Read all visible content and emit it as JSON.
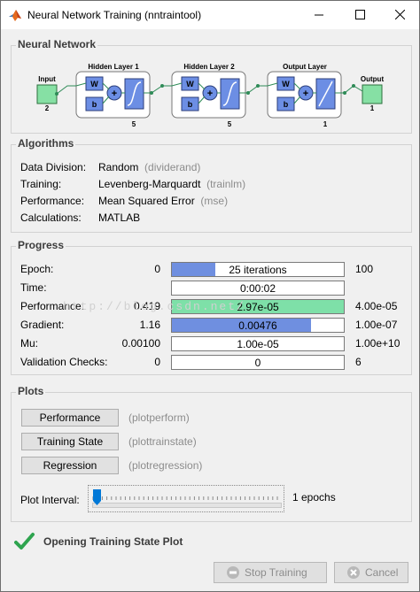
{
  "window": {
    "title": "Neural Network Training (nntraintool)"
  },
  "network": {
    "section_title": "Neural Network",
    "input": {
      "label": "Input",
      "size": "2"
    },
    "hidden1": {
      "label": "Hidden Layer 1",
      "size": "5"
    },
    "hidden2": {
      "label": "Hidden Layer 2",
      "size": "5"
    },
    "output_layer": {
      "label": "Output Layer",
      "size": "1"
    },
    "output": {
      "label": "Output",
      "size": "1"
    },
    "weight_label": "W",
    "bias_label": "b",
    "sum_label": "+"
  },
  "algorithms": {
    "section_title": "Algorithms",
    "rows": [
      {
        "label": "Data Division:",
        "value": "Random",
        "cmd": "(dividerand)"
      },
      {
        "label": "Training:",
        "value": "Levenberg-Marquardt",
        "cmd": "(trainlm)"
      },
      {
        "label": "Performance:",
        "value": "Mean Squared Error",
        "cmd": "(mse)"
      },
      {
        "label": "Calculations:",
        "value": "MATLAB",
        "cmd": ""
      }
    ]
  },
  "progress": {
    "section_title": "Progress",
    "rows": [
      {
        "label": "Epoch:",
        "start": "0",
        "bar_text": "25 iterations",
        "end": "100",
        "fill": 0.25,
        "color": "#6f8fe0"
      },
      {
        "label": "Time:",
        "start": "",
        "bar_text": "0:00:02",
        "end": "",
        "fill": 0,
        "color": "#6f8fe0"
      },
      {
        "label": "Performance:",
        "start": "0.419",
        "bar_text": "2.97e-05",
        "end": "4.00e-05",
        "fill": 1.0,
        "color": "#7ee0a8"
      },
      {
        "label": "Gradient:",
        "start": "1.16",
        "bar_text": "0.00476",
        "end": "1.00e-07",
        "fill": 0.81,
        "color": "#6f8fe0"
      },
      {
        "label": "Mu:",
        "start": "0.00100",
        "bar_text": "1.00e-05",
        "end": "1.00e+10",
        "fill": 0,
        "color": "#6f8fe0"
      },
      {
        "label": "Validation Checks:",
        "start": "0",
        "bar_text": "0",
        "end": "6",
        "fill": 0,
        "color": "#6f8fe0"
      }
    ]
  },
  "plots": {
    "section_title": "Plots",
    "buttons": [
      {
        "label": "Performance",
        "cmd": "(plotperform)"
      },
      {
        "label": "Training State",
        "cmd": "(plottrainstate)"
      },
      {
        "label": "Regression",
        "cmd": "(plotregression)"
      }
    ],
    "interval_label": "Plot Interval:",
    "interval_value": "1 epochs"
  },
  "status": {
    "text": "Opening Training State Plot"
  },
  "footer": {
    "stop_label": "Stop Training",
    "cancel_label": "Cancel"
  },
  "watermark": "http://blog.csdn.net/",
  "colors": {
    "accent_blue": "#6f8fe0",
    "accent_green": "#7ee0a8",
    "check_green": "#2ea44f",
    "slider_thumb": "#0078d7"
  },
  "icons": [
    "matlab-logo-icon",
    "minimize-icon",
    "maximize-icon",
    "close-icon",
    "checkmark-icon",
    "stop-icon",
    "cancel-icon"
  ]
}
